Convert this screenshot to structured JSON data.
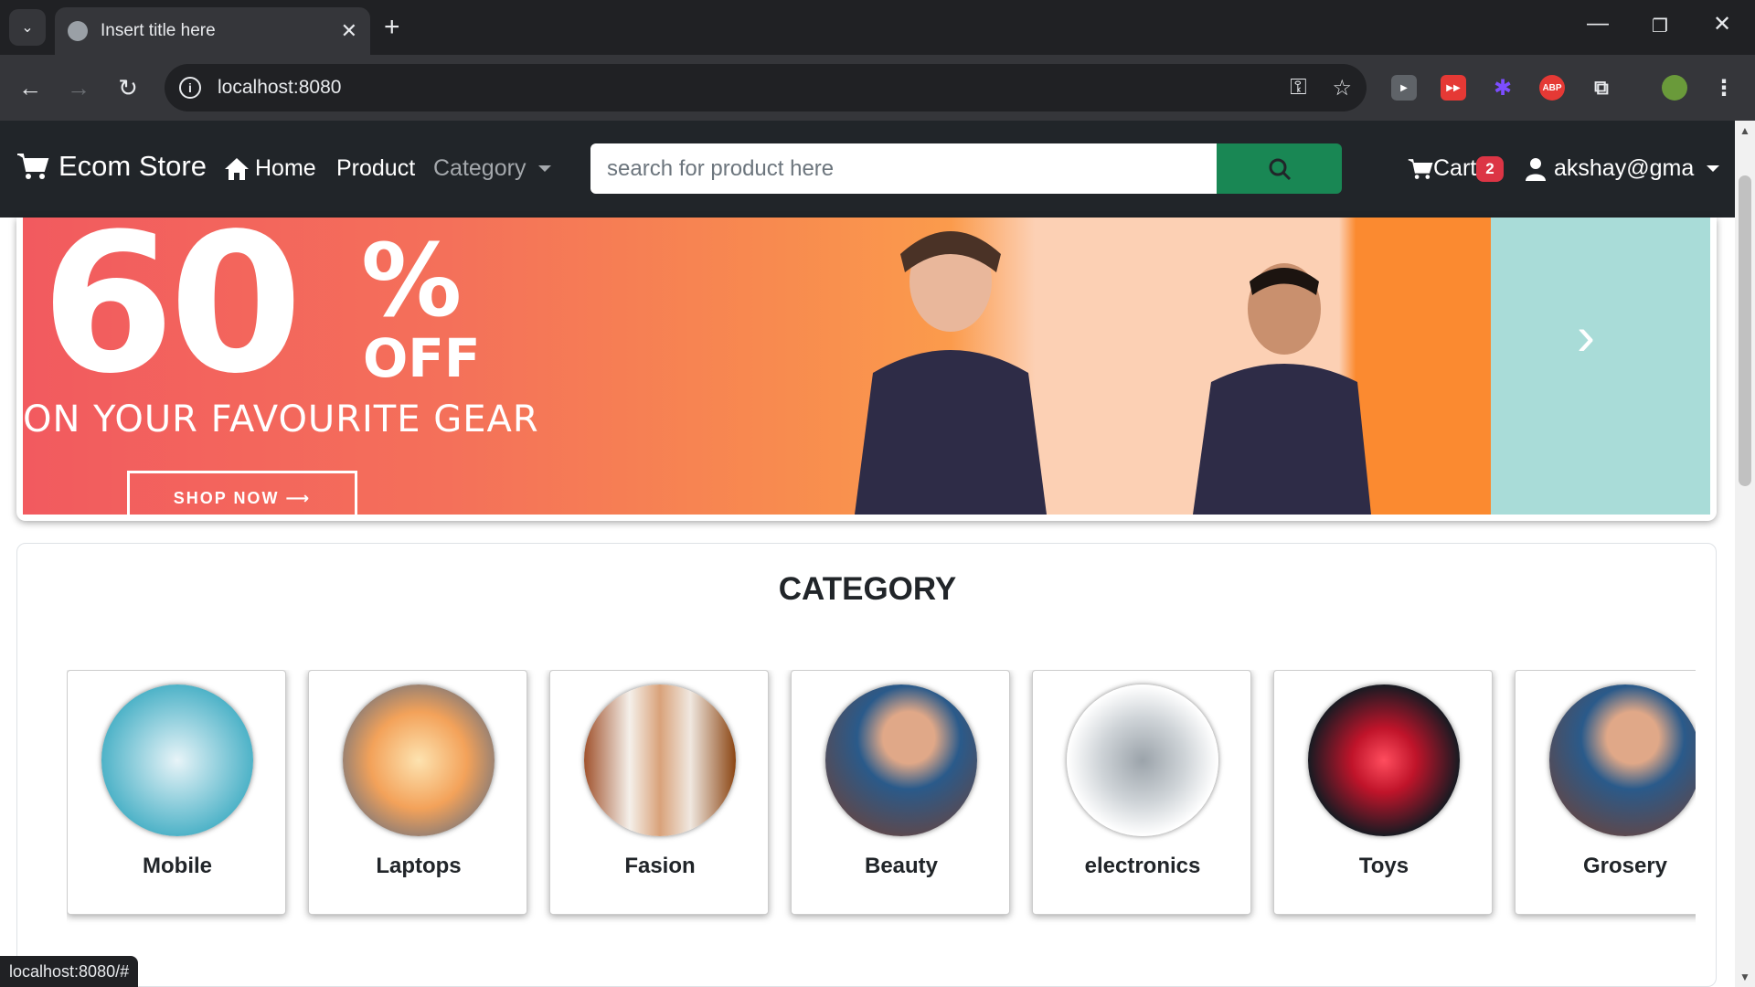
{
  "browser": {
    "tab_title": "Insert title here",
    "url": "localhost:8080",
    "status_url": "localhost:8080/#"
  },
  "navbar": {
    "brand": "Ecom Store",
    "home": "Home",
    "product": "Product",
    "category": "Category",
    "search_placeholder": "search for product here",
    "cart_label": "Cart",
    "cart_count": "2",
    "user": "akshay@gma"
  },
  "banner": {
    "big_number": "60",
    "percent": "%",
    "off": "OFF",
    "subtitle": "ON YOUR FAVOURITE GEAR",
    "button": "SHOP NOW ⟶"
  },
  "category": {
    "title": "CATEGORY",
    "items": [
      {
        "label": "Mobile",
        "color": "#4fb3c8"
      },
      {
        "label": "Laptops",
        "color": "#f3a25a"
      },
      {
        "label": "Fasion",
        "color": "#d9a27a"
      },
      {
        "label": "Beauty",
        "color": "#2a5a8a"
      },
      {
        "label": "electronics",
        "color": "#cfd4d8"
      },
      {
        "label": "Toys",
        "color": "#c0142a"
      },
      {
        "label": "Grosery",
        "color": "#2a5a8a"
      }
    ]
  },
  "colors": {
    "navbar_bg": "#212529",
    "search_btn": "#198754",
    "badge": "#dc3545"
  }
}
